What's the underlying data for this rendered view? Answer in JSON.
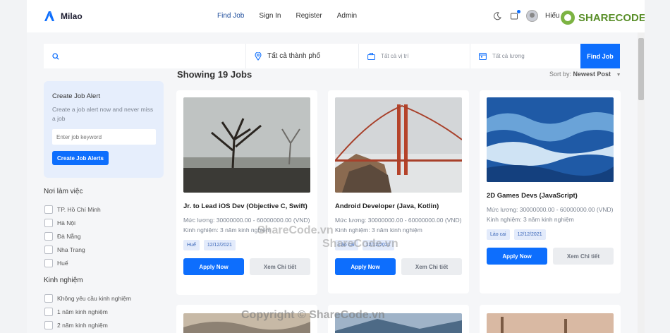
{
  "brand": {
    "name": "Milao",
    "accent": "#0d6efd"
  },
  "nav": {
    "items": [
      {
        "label": "Find Job",
        "active": true
      },
      {
        "label": "Sign In"
      },
      {
        "label": "Register"
      },
      {
        "label": "Admin"
      }
    ]
  },
  "header": {
    "user_name": "Hiếu H",
    "icons": [
      "moon-icon",
      "bell-icon"
    ]
  },
  "search": {
    "keyword_value": "",
    "city_label": "Tất cả thành phố",
    "position_label": "Tất cả vị trí",
    "salary_label": "Tất cả lương",
    "button_label": "Find Job"
  },
  "results": {
    "showing": "Showing 19 Jobs",
    "sort_label": "Sort by:",
    "sort_value": "Newest Post"
  },
  "alert": {
    "title": "Create Job Alert",
    "description": "Create a job alert now and never miss a job",
    "input_placeholder": "Enter job keyword",
    "button_label": "Create Job Alerts"
  },
  "filters": {
    "location": {
      "title": "Nơi làm việc",
      "options": [
        "TP. Hồ Chí Minh",
        "Hà Nội",
        "Đà Nẵng",
        "Nha Trang",
        "Huế"
      ]
    },
    "experience": {
      "title": "Kinh nghiệm",
      "options": [
        "Không yêu cầu kinh nghiệm",
        "1 năm kinh nghiệm",
        "2 năm kinh nghiệm"
      ]
    }
  },
  "jobs": [
    {
      "title": "Jr. to Lead iOS Dev (Objective C, Swift)",
      "salary": "Mức lương: 30000000.00 - 60000000.00 (VND)",
      "experience": "Kinh nghiệm: 3 năm kinh nghiệm",
      "location_tag": "Huế",
      "date_tag": "12/12/2021",
      "apply_label": "Apply Now",
      "detail_label": "Xem Chi tiết",
      "image": "misty-tree-photo"
    },
    {
      "title": "Android Developer (Java, Kotlin)",
      "salary": "Mức lương: 30000000.00 - 60000000.00 (VND)",
      "experience": "Kinh nghiệm: 3 năm kinh nghiệm",
      "location_tag": "Lào cai",
      "date_tag": "12/12/2021",
      "apply_label": "Apply Now",
      "detail_label": "Xem Chi tiết",
      "image": "golden-gate-bridge-photo"
    },
    {
      "title": "2D Games Devs (JavaScript)",
      "salary": "Mức lương: 30000000.00 - 60000000.00 (VND)",
      "experience": "Kinh nghiệm: 3 năm kinh nghiệm",
      "location_tag": "Lào cai",
      "date_tag": "12/12/2021",
      "apply_label": "Apply Now",
      "detail_label": "Xem Chi tiết",
      "image": "ocean-waves-photo"
    }
  ],
  "watermarks": [
    "SHARECODE.vn",
    "ShareCode.vn",
    "Copyright © ShareCode.vn"
  ]
}
